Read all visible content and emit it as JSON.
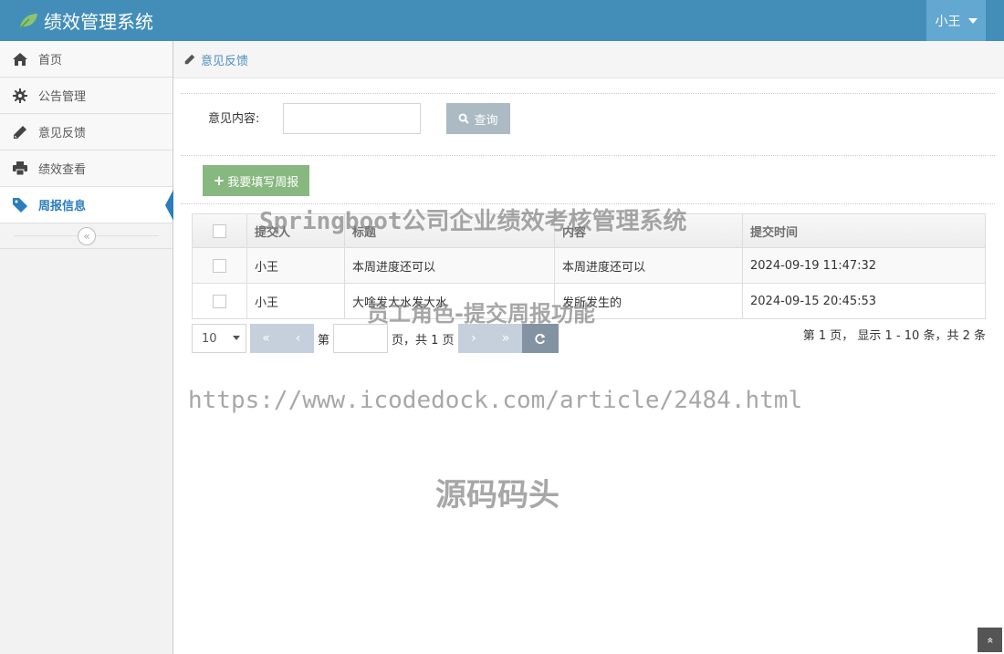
{
  "header": {
    "title": "绩效管理系统",
    "user": "小王"
  },
  "sidebar": {
    "items": [
      {
        "label": "首页",
        "icon": "home-icon"
      },
      {
        "label": "公告管理",
        "icon": "gear-icon"
      },
      {
        "label": "意见反馈",
        "icon": "pencil-icon"
      },
      {
        "label": "绩效查看",
        "icon": "print-icon"
      },
      {
        "label": "周报信息",
        "icon": "tag-icon",
        "active": true
      }
    ],
    "collapse_glyph": "«"
  },
  "breadcrumb": {
    "label": "意见反馈"
  },
  "search": {
    "label": "意见内容:",
    "value": "",
    "button": "查询"
  },
  "add_button": {
    "label": "我要填写周报"
  },
  "table": {
    "columns": [
      "提交人",
      "标题",
      "内容",
      "提交时间"
    ],
    "rows": [
      {
        "submitter": "小王",
        "title": "本周进度还可以",
        "content": "本周进度还可以",
        "time": "2024-09-19 11:47:32"
      },
      {
        "submitter": "小王",
        "title": "大啥发大水发大水",
        "content": "发所发生的",
        "time": "2024-09-15 20:45:53"
      }
    ]
  },
  "pager": {
    "page_size": "10",
    "first": "«",
    "prev": "‹",
    "next": "›",
    "last": "»",
    "page_prefix": "第",
    "page_value": "",
    "page_suffix": "页，共 1 页",
    "info": "第 1 页， 显示 1 - 10 条，共 2 条"
  },
  "watermarks": {
    "line1": "Springboot公司企业绩效考核管理系统",
    "line2": "员工角色-提交周报功能",
    "line3": "https://www.icodedock.com/article/2484.html",
    "line4": "源码码头"
  },
  "scroll_top_glyph": "»",
  "colors": {
    "header": "#438eb9",
    "accent": "#2b7dbc",
    "add_button": "#87b87f",
    "search_button": "#abbac3"
  }
}
